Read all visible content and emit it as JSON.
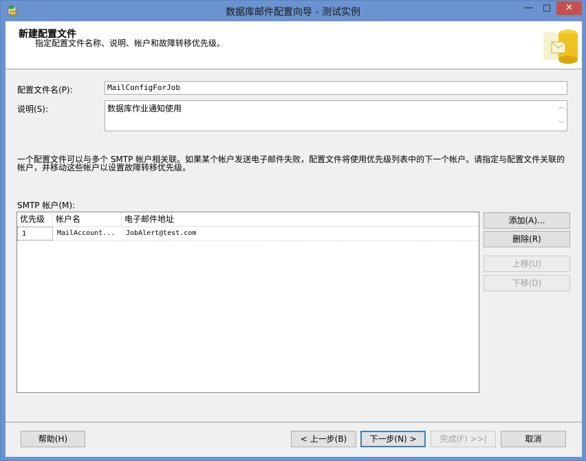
{
  "window": {
    "title": "数据库邮件配置向导 - 测试实例",
    "controls": {
      "minimize": "—",
      "maximize": "□",
      "close": "✕"
    }
  },
  "header": {
    "title": "新建配置文件",
    "subtitle": "指定配置文件名称、说明、帐户和故障转移优先级。"
  },
  "form": {
    "profile_name_label": "配置文件名(P):",
    "profile_name_value": "MailConfigForJob",
    "description_label": "说明(S):",
    "description_value": "数据库作业通知使用"
  },
  "info_text": "一个配置文件可以与多个 SMTP 帐户相关联。如果某个帐户发送电子邮件失败，配置文件将使用优先级列表中的下一个帐户。请指定与配置文件关联的帐户，并移动这些帐户以设置故障转移优先级。",
  "smtp": {
    "label": "SMTP 帐户(M):",
    "columns": [
      "优先级",
      "帐户名",
      "电子邮件地址"
    ],
    "rows": [
      {
        "priority": "1",
        "account": "MailAccount...",
        "email": "JobAlert@test.com"
      }
    ]
  },
  "side_buttons": {
    "add": "添加(A)...",
    "remove": "删除(R)",
    "up": "上移(U)",
    "down": "下移(D)"
  },
  "footer_buttons": {
    "help": "帮助(H)",
    "back": "< 上一步(B)",
    "next": "下一步(N) >",
    "finish": "完成(F) >>|",
    "cancel": "取消"
  }
}
